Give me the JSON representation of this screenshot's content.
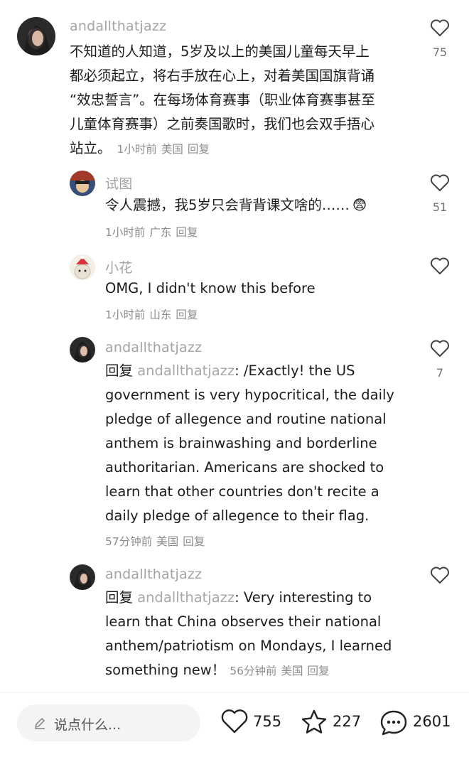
{
  "comments": [
    {
      "username": "andallthatjazz",
      "lines": [
        "不知道的人知道，5岁及以上的美国儿童每天早上",
        "都必须起立，将右手放在心上，对着美国国旗背诵",
        "“效忠誓言”。在每场体育赛事（职业体育赛事甚至",
        "儿童体育赛事）之前奏国歌时，我们也会双手捂心"
      ],
      "last_line": "站立。",
      "time": "1小时前",
      "location": "美国",
      "reply": "回复",
      "likes": "75"
    },
    {
      "username": "试图",
      "text": "令人震撼，我5岁只会背背课文啥的……",
      "emoji": "😨",
      "time": "1小时前",
      "location": "广东",
      "reply": "回复",
      "likes": "51"
    },
    {
      "username": "小花",
      "text": "OMG, I didn't know this before",
      "time": "1小时前",
      "location": "山东",
      "reply": "回复",
      "likes": ""
    },
    {
      "username": "andallthatjazz",
      "reply_prefix": "回复",
      "reply_target": "andallthatjazz",
      "first_line": ": /Exactly! the US",
      "lines": [
        "government is very hypocritical, the daily",
        "pledge of allegence and routine national",
        "anthem is brainwashing and borderline",
        "authoritarian. Americans are shocked to",
        "learn that other countries don't recite a",
        "daily pledge of allegence to their flag."
      ],
      "time": "57分钟前",
      "location": "美国",
      "reply": "回复",
      "likes": "7"
    },
    {
      "username": "andallthatjazz",
      "reply_prefix": "回复",
      "reply_target": "andallthatjazz",
      "first_line": ": Very interesting to",
      "lines": [
        "learn that China observes their national",
        "anthem/patriotism on Mondays, I learned"
      ],
      "last_line": "something new！",
      "time": "56分钟前",
      "location": "美国",
      "reply": "回复",
      "likes": ""
    }
  ],
  "bottom_bar": {
    "placeholder": "说点什么...",
    "like_count": "755",
    "star_count": "227",
    "comment_count": "2601"
  },
  "icons": [
    "heart-icon",
    "star-icon",
    "comment-bubble-icon",
    "pen-icon"
  ]
}
